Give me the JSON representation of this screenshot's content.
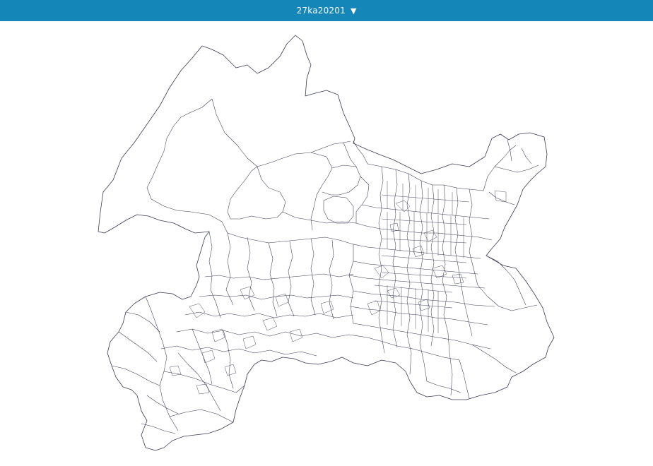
{
  "header": {
    "title": "27ka20201",
    "dropdown_icon": "triangle-down-icon",
    "background_color": "#1486b8",
    "text_color": "#ffffff"
  },
  "map": {
    "stroke_color": "#3a3a55",
    "fill_color": "#ffffff"
  }
}
